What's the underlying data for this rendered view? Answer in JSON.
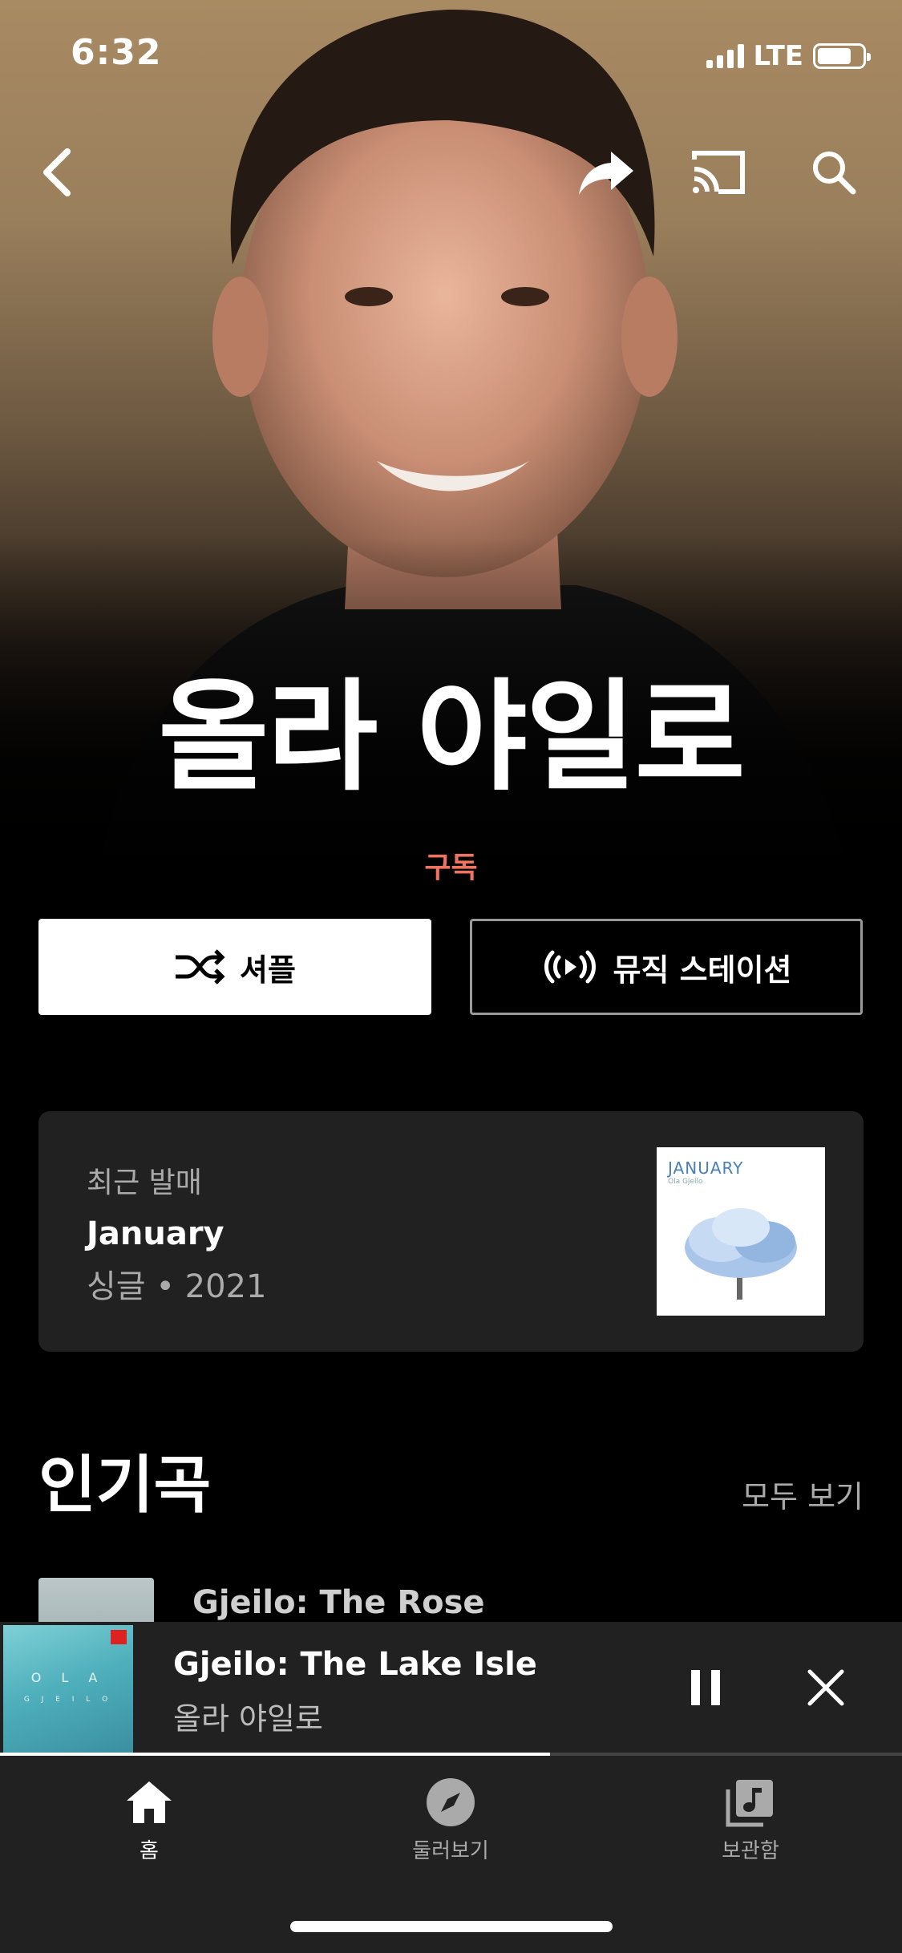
{
  "status_bar": {
    "time": "6:32",
    "network": "LTE"
  },
  "artist": {
    "name": "올라 야일로",
    "subscribe_label": "구독"
  },
  "actions": {
    "shuffle_label": "셔플",
    "station_label": "뮤직 스테이션"
  },
  "latest_release": {
    "section_label": "최근 발매",
    "title": "January",
    "meta": "싱글 • 2021",
    "art_title": "JANUARY",
    "art_subtitle": "Ola Gjeilo"
  },
  "popular": {
    "title": "인기곡",
    "see_all": "모두 보기",
    "songs": [
      {
        "title": "Gjeilo: The Rose"
      }
    ]
  },
  "now_playing": {
    "title": "Gjeilo: The Lake Isle",
    "artist": "올라 야일로",
    "art_text": "O L A",
    "art_text2": "G J E I L O",
    "progress": 0.61
  },
  "bottom_nav": {
    "tabs": [
      {
        "label": "홈",
        "icon": "home-icon"
      },
      {
        "label": "둘러보기",
        "icon": "compass-icon"
      },
      {
        "label": "보관함",
        "icon": "library-icon"
      }
    ]
  },
  "colors": {
    "accent": "#f0735f",
    "card_bg": "#212121"
  }
}
